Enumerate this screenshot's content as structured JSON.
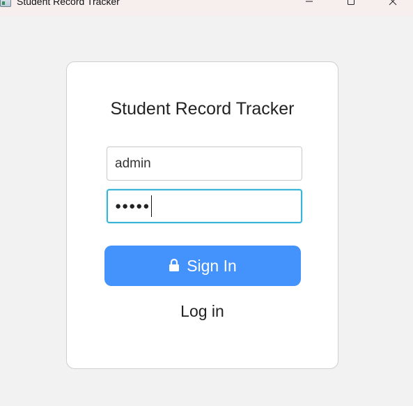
{
  "window": {
    "title": "Student Record Tracker",
    "icon": "app-window-icon",
    "controls": {
      "minimize_icon": "minimize-icon",
      "maximize_icon": "maximize-icon",
      "close_icon": "close-icon"
    }
  },
  "login": {
    "heading": "Student Record Tracker",
    "username_value": "admin",
    "password_mask": "●●●●●",
    "signin_label": "Sign In",
    "signin_icon": "lock-icon",
    "login_link_label": "Log in"
  },
  "colors": {
    "button_bg": "#4492fb",
    "focus_border": "#38b4d6",
    "card_bg": "#ffffff",
    "window_bg": "#f2f2f2"
  }
}
